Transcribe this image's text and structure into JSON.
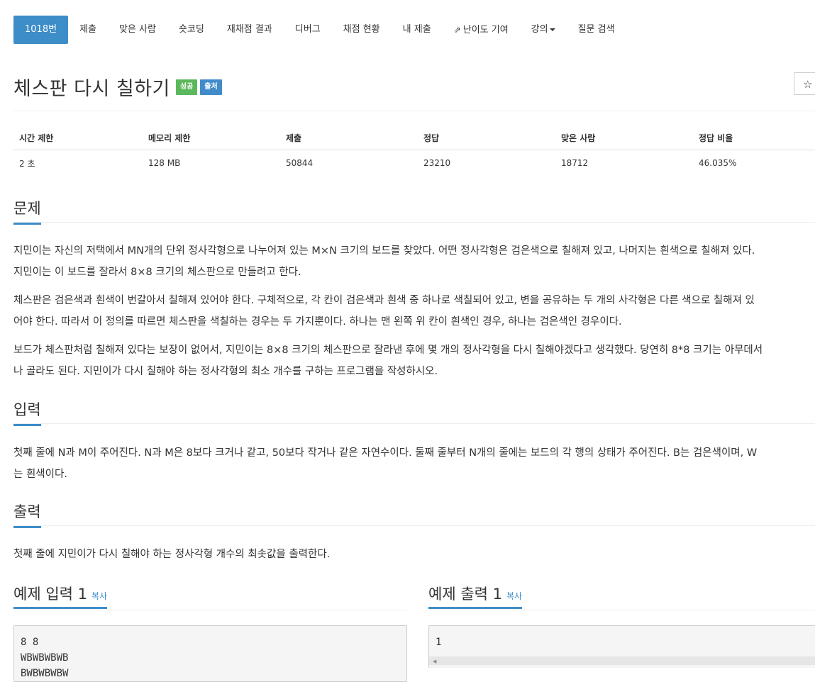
{
  "nav": {
    "tabs": [
      {
        "label": "1018번"
      },
      {
        "label": "제출"
      },
      {
        "label": "맞은 사람"
      },
      {
        "label": "숏코딩"
      },
      {
        "label": "재채점 결과"
      },
      {
        "label": "디버그"
      },
      {
        "label": "채점 현황"
      },
      {
        "label": "내 제출"
      },
      {
        "label": "난이도 기여"
      },
      {
        "label": "강의"
      },
      {
        "label": "질문 검색"
      }
    ]
  },
  "problem": {
    "title": "체스판 다시 칠하기",
    "tags": [
      "성공",
      "출처"
    ],
    "star": "☆"
  },
  "info_table": {
    "headers": [
      "시간 제한",
      "메모리 제한",
      "제출",
      "정답",
      "맞은 사람",
      "정답 비율"
    ],
    "values": [
      "2 초",
      "128 MB",
      "50844",
      "23210",
      "18712",
      "46.035%"
    ]
  },
  "sections": {
    "description_title": "문제",
    "description": [
      "지민이는 자신의 저택에서 MN개의 단위 정사각형으로 나누어져 있는 M×N 크기의 보드를 찾았다. 어떤 정사각형은 검은색으로 칠해져 있고, 나머지는 흰색으로 칠해져 있다.",
      "지민이는 이 보드를 잘라서 8×8 크기의 체스판으로 만들려고 한다.",
      "체스판은 검은색과 흰색이 번갈아서 칠해져 있어야 한다. 구체적으로, 각 칸이 검은색과 흰색 중 하나로 색칠되어 있고, 변을 공유하는 두 개의 사각형은 다른 색으로 칠해져 있",
      "어야 한다. 따라서 이 정의를 따르면 체스판을 색칠하는 경우는 두 가지뿐이다. 하나는 맨 왼쪽 위 칸이 흰색인 경우, 하나는 검은색인 경우이다.",
      "보드가 체스판처럼 칠해져 있다는 보장이 없어서, 지민이는 8×8 크기의 체스판으로 잘라낸 후에 몇 개의 정사각형을 다시 칠해야겠다고 생각했다. 당연히 8*8 크기는 아무데서",
      "나 골라도 된다. 지민이가 다시 칠해야 하는 정사각형의 최소 개수를 구하는 프로그램을 작성하시오."
    ],
    "input_title": "입력",
    "input": [
      "첫째 줄에 N과 M이 주어진다. N과 M은 8보다 크거나 같고, 50보다 작거나 같은 자연수이다. 둘째 줄부터 N개의 줄에는 보드의 각 행의 상태가 주어진다. B는 검은색이며, W",
      "는 흰색이다."
    ],
    "output_title": "출력",
    "output": "첫째 줄에 지민이가 다시 칠해야 하는 정사각형 개수의 최솟값을 출력한다."
  },
  "samples": {
    "input_title": "예제 입력 1",
    "output_title": "예제 출력 1",
    "copy_label": "복사",
    "input_text": "8 8\nWBWBWBWB\nBWBWBWBW",
    "output_text": "1"
  }
}
